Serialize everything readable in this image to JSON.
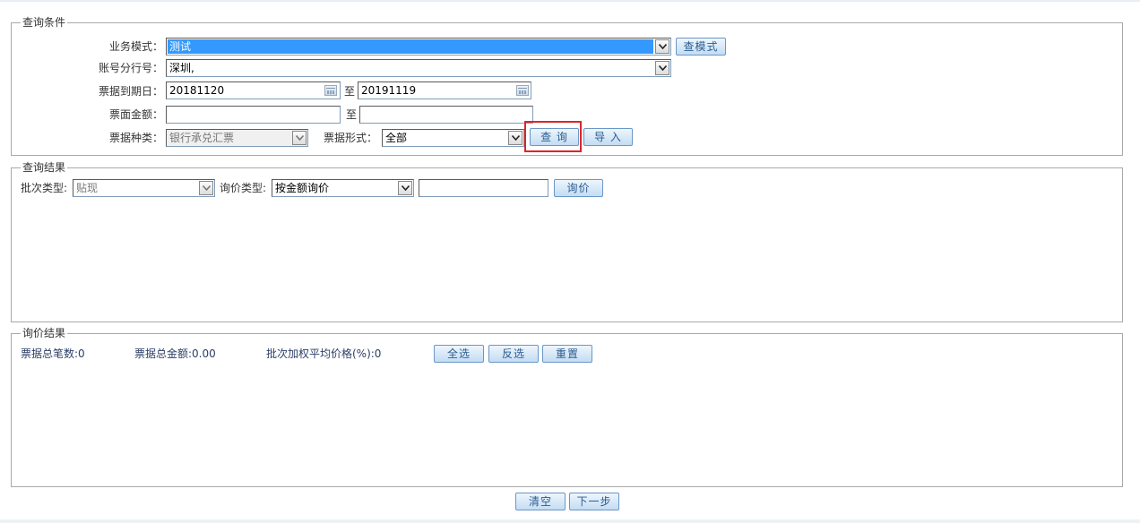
{
  "query_conditions": {
    "legend": "查询条件",
    "business_mode_label": "业务模式：",
    "business_mode_value": "测试",
    "check_mode_button": "查模式",
    "account_branch_label": "账号分行号：",
    "account_branch_value": "深圳,",
    "due_date_label": "票据到期日：",
    "due_date_from": "20181120",
    "to_label_1": "至",
    "due_date_to": "20191119",
    "face_amount_label": "票面金额：",
    "face_amount_from": "",
    "to_label_2": "至",
    "face_amount_to": "",
    "bill_type_label": "票据种类：",
    "bill_type_value": "银行承兑汇票",
    "bill_form_label": "票据形式：",
    "bill_form_value": "全部",
    "query_button": "查 询",
    "import_button": "导 入"
  },
  "query_results": {
    "legend": "查询结果",
    "batch_type_label": "批次类型:",
    "batch_type_value": "贴现",
    "inquiry_type_label": "询价类型:",
    "inquiry_type_value": "按金额询价",
    "inquiry_input_value": "",
    "inquiry_button": "询价"
  },
  "inquiry_results": {
    "legend": "询价结果",
    "total_count_text": "票据总笔数:0",
    "total_amount_text": "票据总金额:0.00",
    "weighted_avg_text": "批次加权平均价格(%):0",
    "select_all_button": "全选",
    "invert_button": "反选",
    "reset_button": "重置"
  },
  "footer": {
    "clear_button": "清空",
    "next_button": "下一步"
  },
  "colors": {
    "highlight": "#d9262b",
    "selection": "#3399ff",
    "button_text": "#2a5c90"
  }
}
